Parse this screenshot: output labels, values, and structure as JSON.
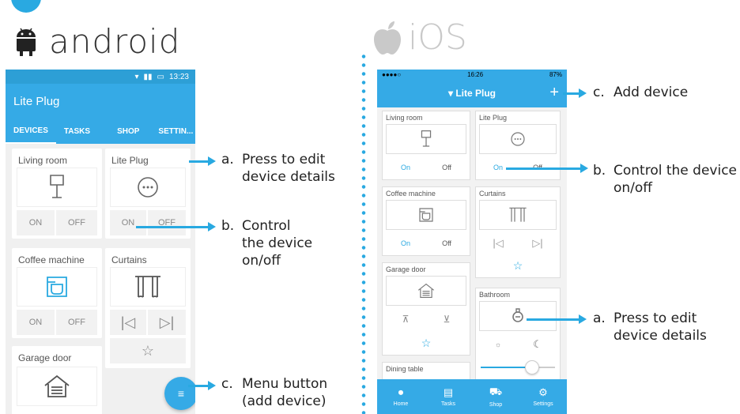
{
  "headings": {
    "android": "android",
    "ios": "iOS"
  },
  "android": {
    "status_time": "13:23",
    "app_title": "Lite Plug",
    "tabs": [
      "DEVICES",
      "TASKS",
      "SHOP",
      "SETTIN..."
    ],
    "cards": {
      "living_room": {
        "title": "Living room",
        "on": "ON",
        "off": "OFF"
      },
      "lite_plug": {
        "title": "Lite Plug",
        "on": "ON",
        "off": "OFF"
      },
      "coffee_machine": {
        "title": "Coffee machine",
        "on": "ON",
        "off": "OFF"
      },
      "curtains": {
        "title": "Curtains"
      },
      "garage_door": {
        "title": "Garage door"
      }
    }
  },
  "ios": {
    "status_time": "16:26",
    "battery": "87%",
    "nav_title": "▾ Lite Plug",
    "plus": "+",
    "cards": {
      "living_room": {
        "title": "Living room",
        "on": "On",
        "off": "Off"
      },
      "lite_plug": {
        "title": "Lite Plug",
        "on": "On",
        "off": "Off"
      },
      "coffee_machine": {
        "title": "Coffee machine",
        "on": "On",
        "off": "Off"
      },
      "curtains": {
        "title": "Curtains"
      },
      "garage_door": {
        "title": "Garage door"
      },
      "bathroom": {
        "title": "Bathroom"
      },
      "dining_table": {
        "title": "Dining table"
      }
    },
    "tabbar": [
      "Home",
      "Tasks",
      "Shop",
      "Settings"
    ]
  },
  "annotations": {
    "android_a": {
      "key": "a.",
      "line1": "Press to edit",
      "line2": "device details"
    },
    "android_b": {
      "key": "b.",
      "line1": "Control",
      "line2": "the device",
      "line3": "on/off"
    },
    "android_c": {
      "key": "c.",
      "line1": "Menu button",
      "line2": "(add device)"
    },
    "ios_c": {
      "key": "c.",
      "line1": "Add device"
    },
    "ios_b": {
      "key": "b.",
      "line1": "Control the device",
      "line2": "on/off"
    },
    "ios_a": {
      "key": "a.",
      "line1": "Press to edit",
      "line2": "device details"
    }
  },
  "colors": {
    "accent": "#35aae6",
    "arrow": "#29a9e1"
  }
}
